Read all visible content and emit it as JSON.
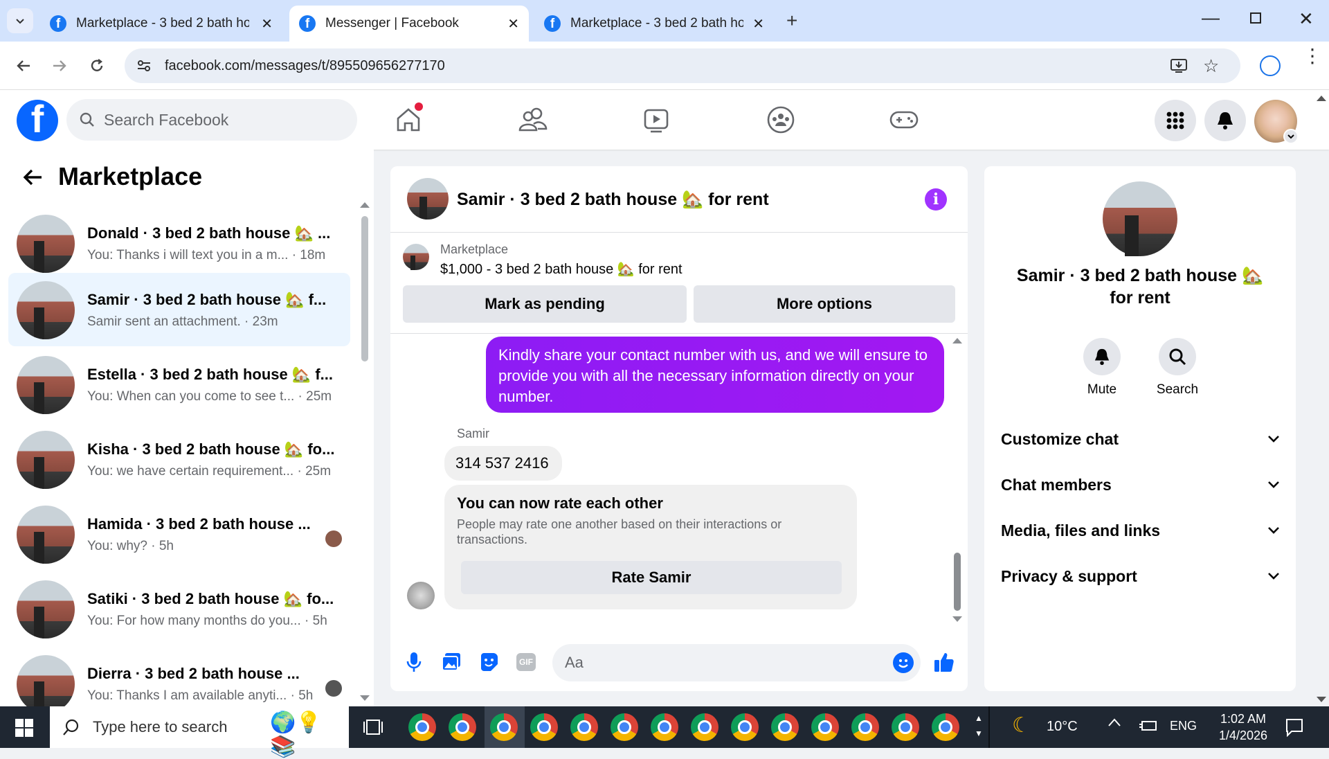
{
  "browser": {
    "tabs": [
      {
        "title": "Marketplace - 3 bed 2 bath hou",
        "active": false
      },
      {
        "title": "Messenger | Facebook",
        "active": true
      },
      {
        "title": "Marketplace - 3 bed 2 bath hou",
        "active": false
      }
    ],
    "url": "facebook.com/messages/t/895509656277170"
  },
  "fb": {
    "search_placeholder": "Search Facebook"
  },
  "sidebar": {
    "title": "Marketplace",
    "conversations": [
      {
        "name": "Donald · 3 bed 2 bath house 🏡 ...",
        "preview": "You: Thanks i will text you in a m... · 18m",
        "active": false
      },
      {
        "name": "Samir · 3 bed 2 bath house 🏡 f...",
        "preview": "Samir sent an attachment. · 23m",
        "active": true
      },
      {
        "name": "Estella · 3 bed 2 bath house 🏡 f...",
        "preview": "You: When can you come to see t... · 25m",
        "active": false
      },
      {
        "name": "Kisha · 3 bed 2 bath house 🏡 fo...",
        "preview": "You: we have certain requirement... · 25m",
        "active": false
      },
      {
        "name": "Hamida · 3 bed 2 bath house ...",
        "preview": "You: why? · 5h",
        "active": false
      },
      {
        "name": "Satiki · 3 bed 2 bath house 🏡 fo...",
        "preview": "You: For how many months do you... · 5h",
        "active": false
      },
      {
        "name": "Dierra · 3 bed 2 bath house ...",
        "preview": "You: Thanks I am available anyti... · 5h",
        "active": false
      }
    ]
  },
  "chat": {
    "title": "Samir · 3 bed 2 bath house 🏡 for rent",
    "listing": {
      "source": "Marketplace",
      "details": "$1,000 - 3 bed 2 bath house 🏡 for rent",
      "mark_pending_label": "Mark as pending",
      "more_options_label": "More options"
    },
    "messages": {
      "outgoing": "Kindly share your contact number with us, and we will ensure to provide you with all the necessary information directly on your number.",
      "sender": "Samir",
      "incoming": "314 537 2416",
      "rate_title": "You can now rate each other",
      "rate_text": "People may rate one another based on their interactions or transactions.",
      "rate_button": "Rate Samir"
    },
    "composer_placeholder": "Aa"
  },
  "info_panel": {
    "title_line1": "Samir · 3 bed 2 bath house 🏡",
    "title_line2": "for rent",
    "mute_label": "Mute",
    "search_label": "Search",
    "sections": [
      "Customize chat",
      "Chat members",
      "Media, files and links",
      "Privacy & support"
    ]
  },
  "taskbar": {
    "search_placeholder": "Type here to search",
    "weather": "10°C",
    "lang": "ENG",
    "time": "1:02 AM",
    "date": "1/4/2026"
  },
  "colors": {
    "fb_blue": "#0866ff",
    "messenger_purple": "#a033ff",
    "active_convo": "#ebf5ff"
  }
}
